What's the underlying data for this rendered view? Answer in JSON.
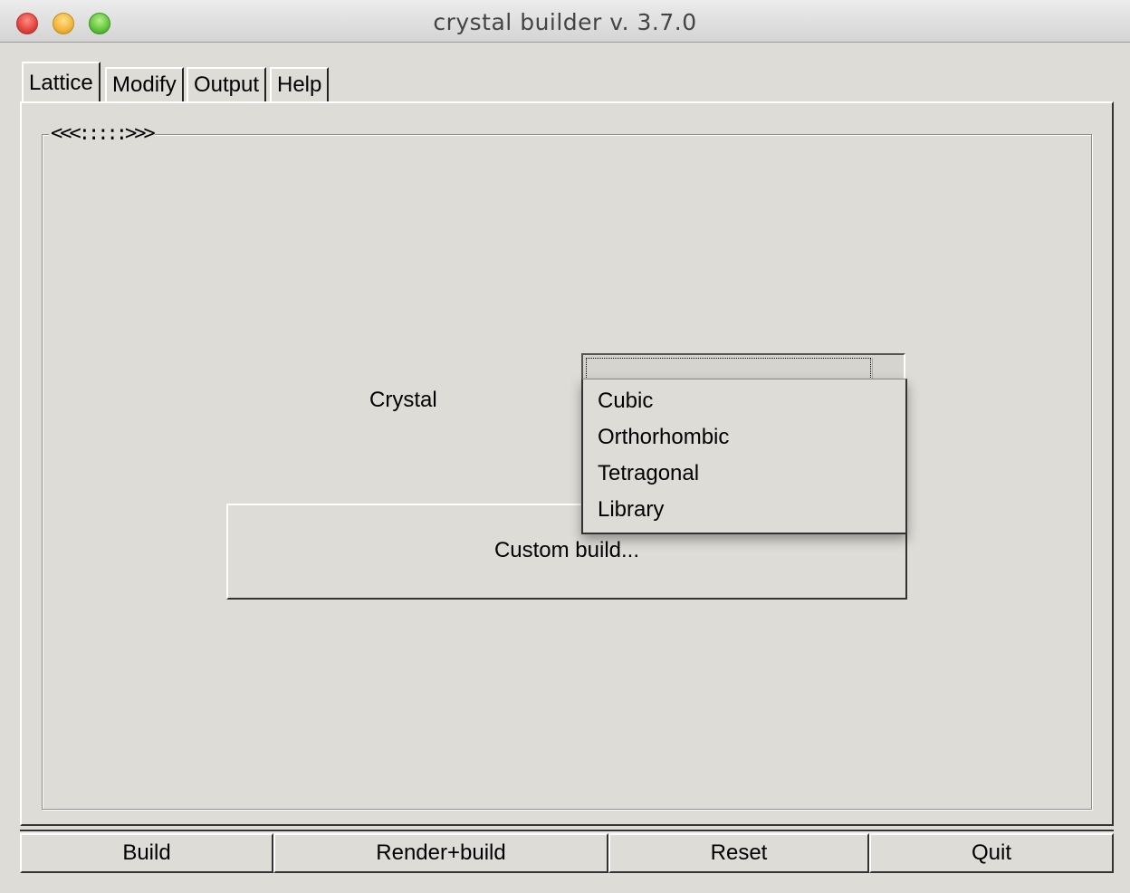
{
  "window": {
    "title": "crystal builder v. 3.7.0"
  },
  "tabs": [
    {
      "label": "Lattice",
      "active": true
    },
    {
      "label": "Modify",
      "active": false
    },
    {
      "label": "Output",
      "active": false
    },
    {
      "label": "Help",
      "active": false
    }
  ],
  "lattice": {
    "group_label": "<<<:::::>>>",
    "crystal_label": "Crystal",
    "crystal_select": {
      "value": "",
      "options": [
        "Cubic",
        "Orthorhombic",
        "Tetragonal",
        "Library"
      ]
    },
    "custom_build_label": "Custom build..."
  },
  "footer": {
    "build": "Build",
    "render_build": "Render+build",
    "reset": "Reset",
    "quit": "Quit"
  }
}
